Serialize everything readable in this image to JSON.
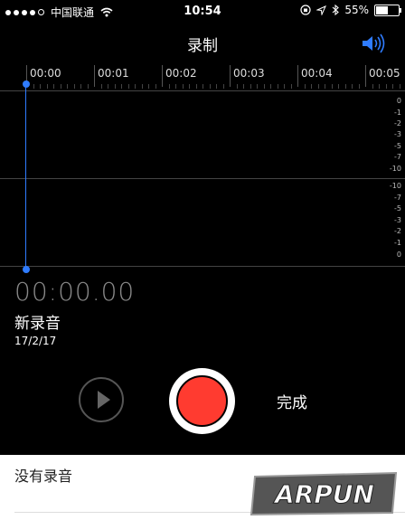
{
  "status_bar": {
    "carrier": "中国联通",
    "time": "10:54",
    "battery": "55%",
    "battery_level": 0.55
  },
  "header": {
    "title": "录制"
  },
  "timeline": {
    "labels": [
      "00:00",
      "00:01",
      "00:02",
      "00:03",
      "00:04",
      "00:05"
    ]
  },
  "meter": {
    "upper_scale": [
      "0",
      "-1",
      "-2",
      "-3",
      "-5",
      "-7",
      "-10"
    ],
    "lower_scale": [
      "-10",
      "-7",
      "-5",
      "-3",
      "-2",
      "-1",
      "0"
    ]
  },
  "recording": {
    "elapsed": "00:00.00",
    "name": "新录音",
    "date": "17/2/17"
  },
  "controls": {
    "done_label": "完成"
  },
  "list": {
    "empty_text": "没有录音"
  },
  "watermark": {
    "text": "ARPUN"
  },
  "colors": {
    "accent": "#2f7cff",
    "record": "#ff3b30"
  }
}
